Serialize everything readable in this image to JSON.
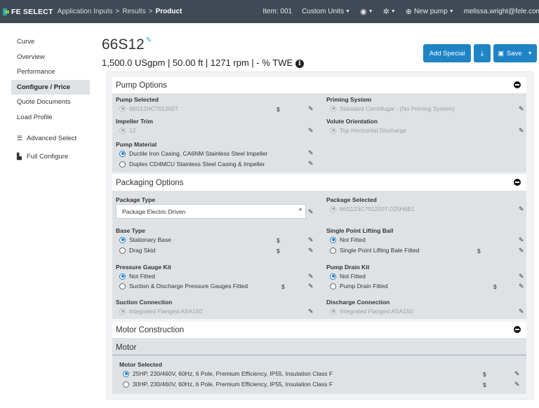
{
  "nav": {
    "logo_text": "FE SELECT",
    "crumbs": [
      "Application Inputs",
      "Results",
      "Product"
    ],
    "separator": ">",
    "item": "Item: 001",
    "units": "Custom Units",
    "new_pump": "New pump",
    "user": "melissa.wright@fele.com"
  },
  "sidebar": {
    "items": [
      {
        "label": "Curve"
      },
      {
        "label": "Overview"
      },
      {
        "label": "Performance"
      },
      {
        "label": "Configure / Price"
      },
      {
        "label": "Quote Documents"
      },
      {
        "label": "Load Profile"
      },
      {
        "label": "Advanced Select",
        "icon": "sliders-icon"
      },
      {
        "label": "Full Configure",
        "icon": "factory-icon"
      }
    ]
  },
  "header": {
    "title": "66S12",
    "subtitle": "1,500.0 USgpm | 50.00 ft | 1271 rpm  |  - % TWE"
  },
  "actions": {
    "add_special": "Add Special",
    "save": "Save"
  },
  "sections": {
    "pump_options": {
      "title": "Pump Options",
      "pump_selected_label": "Pump Selected",
      "pump_selected_value": "66S12HC701200T",
      "priming_label": "Priming System",
      "priming_value": "Standard Centrifugal - (No Priming System)",
      "impeller_label": "Impeller Trim",
      "impeller_value": "12",
      "volute_label": "Volute Orientation",
      "volute_value": "Top Horizontal Discharge",
      "material_label": "Pump Material",
      "material_options": [
        "Ductile Iron Casing, CA6NM Stainless Steel Impeller",
        "Duplex CD4MCU Stainless Steel Casing & Impeller"
      ]
    },
    "packaging_options": {
      "title": "Packaging Options",
      "package_type_label": "Package Type",
      "package_type_value": "Package Electric Driven",
      "package_selected_label": "Package Selected",
      "package_selected_value": "66S123C701200T-025H6B1",
      "base_type_label": "Base Type",
      "base_type_options": [
        "Stationary Base",
        "Drag Skid"
      ],
      "lifting_label": "Single Point Lifting Bail",
      "lifting_options": [
        "Not Fitted",
        "Single Point Lifting Bale Fitted"
      ],
      "gauge_label": "Pressure Gauge Kit",
      "gauge_options": [
        "Not Fitted",
        "Suction & Discharge Pressure Gauges Fitted"
      ],
      "drain_label": "Pump Drain Kit",
      "drain_options": [
        "Not Fitted",
        "Pump Drain Fitted"
      ],
      "suction_label": "Suction Connection",
      "suction_value": "Integrated Flanged ASA150",
      "discharge_label": "Discharge Connection",
      "discharge_value": "Integrated Flanged ASA150"
    },
    "motor_construction": {
      "title": "Motor Construction",
      "sub_title": "Motor",
      "motor_selected_label": "Motor Selected",
      "motor_options": [
        "25HP, 230/460V, 60Hz, 6 Pole, Premium Efficiency, IP55, Insulation Class F",
        "30HP, 230/460V, 60Hz, 6 Pole, Premium Efficiency, IP55, Insulation Class F"
      ]
    }
  },
  "price_symbol": "$",
  "colors": {
    "nav_bg": "#404a55",
    "accent": "#1f84c6",
    "panel_bg": "#dfe2e5"
  }
}
